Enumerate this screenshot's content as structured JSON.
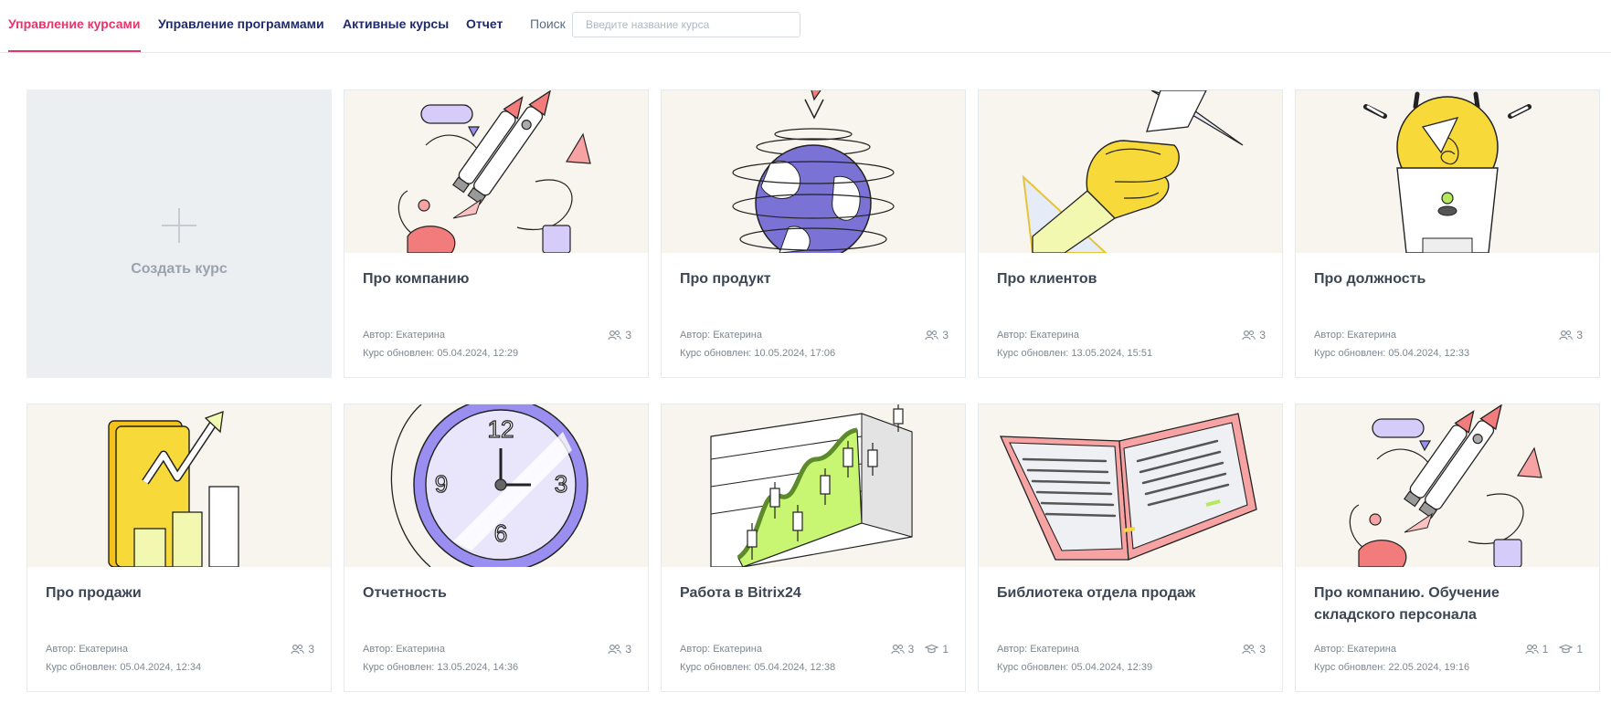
{
  "tabs": [
    {
      "label": "Управление курсами",
      "active": true
    },
    {
      "label": "Управление программами",
      "active": false
    },
    {
      "label": "Активные курсы",
      "active": false
    },
    {
      "label": "Отчет",
      "active": false
    }
  ],
  "search": {
    "label": "Поиск",
    "placeholder": "Введите название курса",
    "value": ""
  },
  "create_card": {
    "label": "Создать курс"
  },
  "accent_color": "#e8336b",
  "nav_color": "#1f2a6b",
  "courses": [
    {
      "title": "Про компанию",
      "author": "Автор: Екатерина",
      "updated": "Курс обновлен: 05.04.2024, 12:29",
      "participants": "3",
      "graduates": null,
      "illustration": "rocket-illustration"
    },
    {
      "title": "Про продукт",
      "author": "Автор: Екатерина",
      "updated": "Курс обновлен: 10.05.2024, 17:06",
      "participants": "3",
      "graduates": null,
      "illustration": "globe-illustration"
    },
    {
      "title": "Про клиентов",
      "author": "Автор: Екатерина",
      "updated": "Курс обновлен: 13.05.2024, 15:51",
      "participants": "3",
      "graduates": null,
      "illustration": "handshake-illustration"
    },
    {
      "title": "Про должность",
      "author": "Автор: Екатерина",
      "updated": "Курс обновлен: 05.04.2024, 12:33",
      "participants": "3",
      "graduates": null,
      "illustration": "lightbulb-illustration"
    },
    {
      "title": "Про продажи",
      "author": "Автор: Екатерина",
      "updated": "Курс обновлен: 05.04.2024, 12:34",
      "participants": "3",
      "graduates": null,
      "illustration": "growth-chart-illustration"
    },
    {
      "title": "Отчетность",
      "author": "Автор: Екатерина",
      "updated": "Курс обновлен: 13.05.2024, 14:36",
      "participants": "3",
      "graduates": null,
      "illustration": "clock-illustration"
    },
    {
      "title": "Работа в Bitrix24",
      "author": "Автор: Екатерина",
      "updated": "Курс обновлен: 05.04.2024, 12:38",
      "participants": "3",
      "graduates": "1",
      "illustration": "candlestick-chart-illustration"
    },
    {
      "title": "Библиотека отдела продаж",
      "author": "Автор: Екатерина",
      "updated": "Курс обновлен: 05.04.2024, 12:39",
      "participants": "3",
      "graduates": null,
      "illustration": "book-illustration"
    },
    {
      "title": "Про компанию. Обучение складского персонала",
      "author": "Автор: Екатерина",
      "updated": "Курс обновлен: 22.05.2024, 19:16",
      "participants": "1",
      "graduates": "1",
      "illustration": "rocket-illustration"
    }
  ]
}
